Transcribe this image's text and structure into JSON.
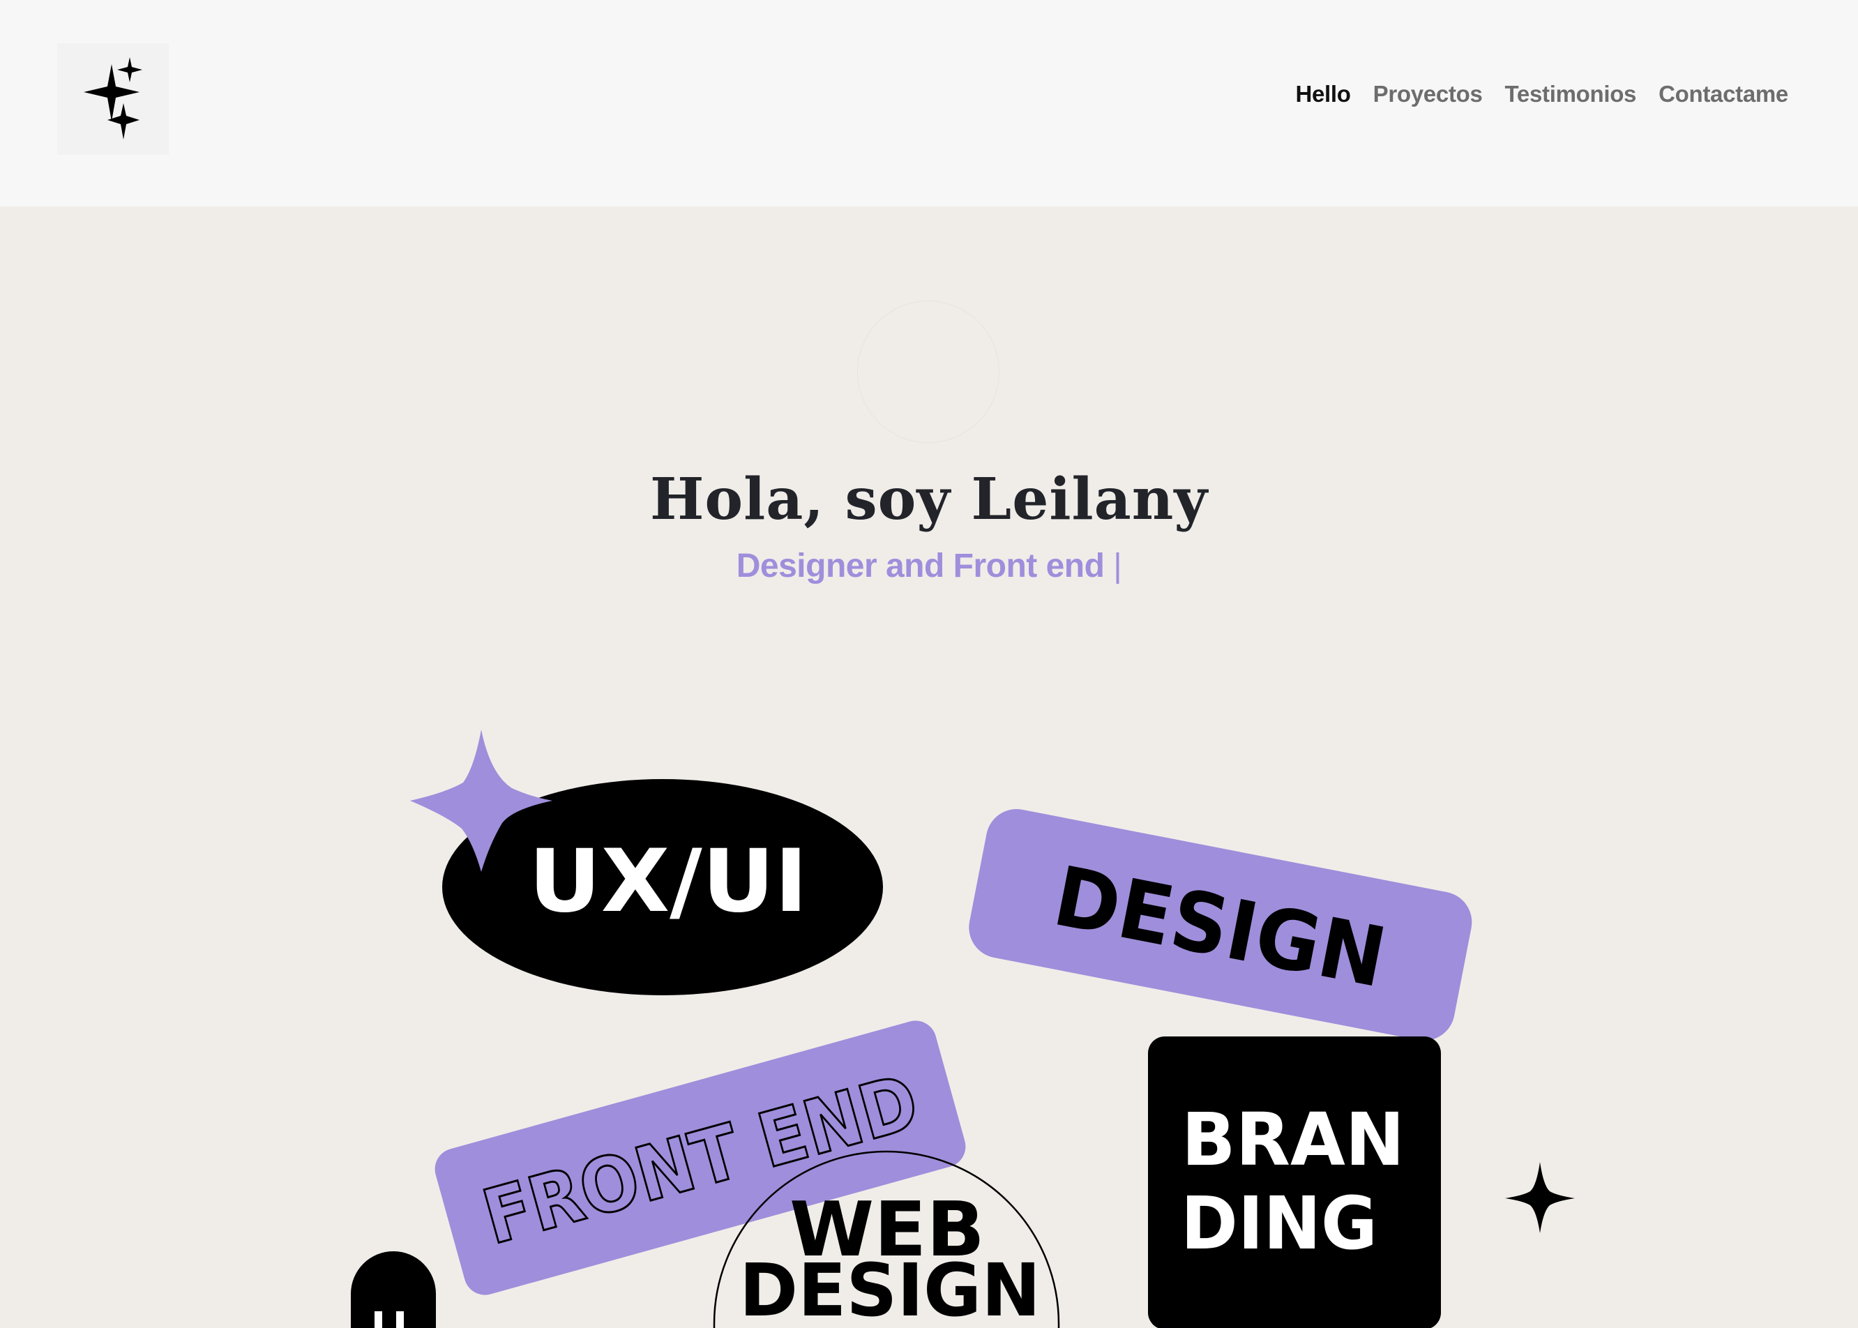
{
  "nav": {
    "items": [
      {
        "label": "Hello",
        "active": true
      },
      {
        "label": "Proyectos",
        "active": false
      },
      {
        "label": "Testimonios",
        "active": false
      },
      {
        "label": "Contactame",
        "active": false
      }
    ]
  },
  "logo": {
    "icon": "sparkles-icon"
  },
  "hero": {
    "title": "Hola, soy Leilany",
    "subtitle": "Designer and Front end",
    "caret": "|"
  },
  "stickers": {
    "uxui": "UX/UI",
    "design": "DESIGN",
    "frontend": "FRONT END",
    "webdesign_line1": "WEB",
    "webdesign_line2": "DESIGN",
    "branding_line1": "BRAN",
    "branding_line2": "DING"
  },
  "colors": {
    "header_bg": "#f7f7f7",
    "page_bg": "#f0ede9",
    "accent_purple": "#9f8edb",
    "ink": "#000000",
    "title": "#22242a"
  }
}
